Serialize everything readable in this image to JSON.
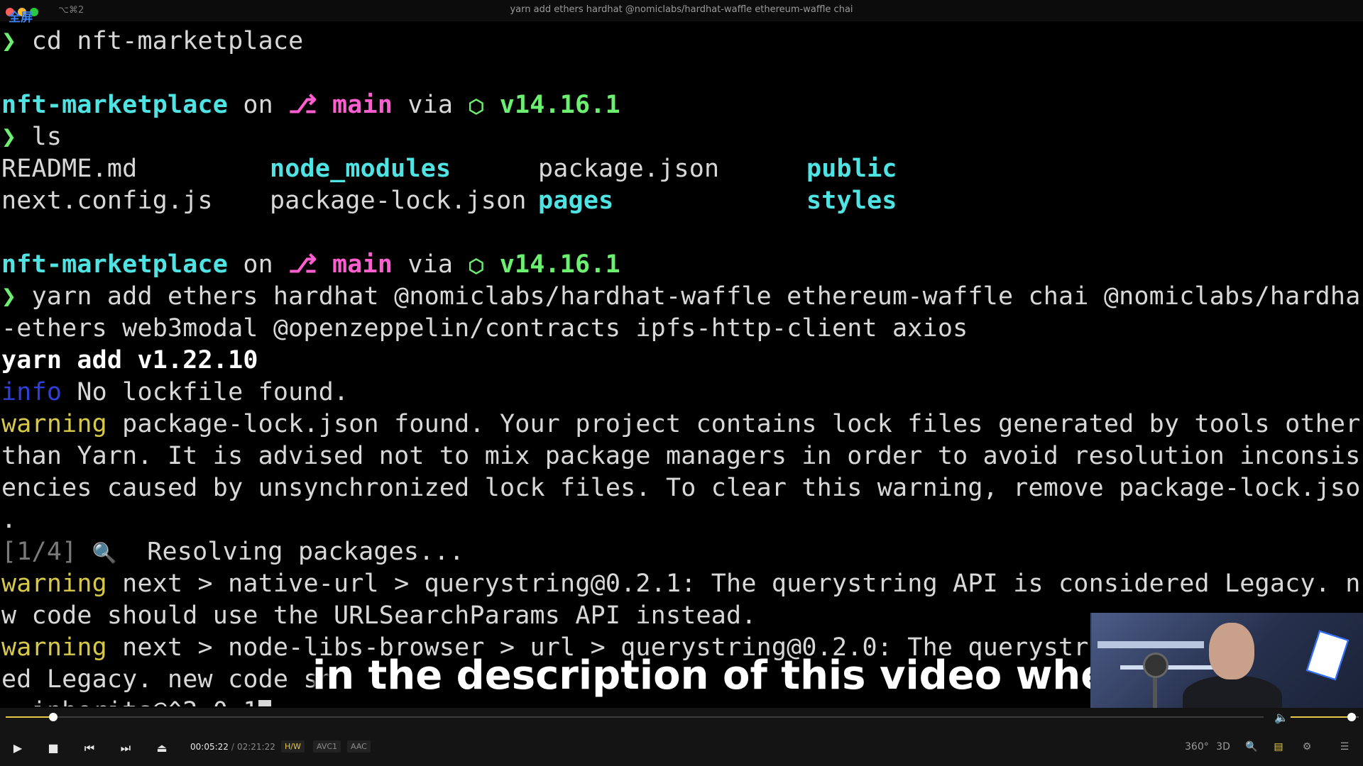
{
  "window": {
    "badge": "全屏",
    "shortcut": "⌥⌘2",
    "title": "yarn add ethers hardhat @nomiclabs/hardhat-waffle ethereum-waffle chai"
  },
  "terminal": {
    "cmd1": "cd nft-marketplace",
    "prompt": {
      "dir": "nft-marketplace",
      "on": "on",
      "branch": "main",
      "via": "via",
      "node": "v14.16.1"
    },
    "cmd2": "ls",
    "ls_row1": [
      "README.md",
      "node_modules",
      "package.json",
      "public"
    ],
    "ls_row2": [
      "next.config.js",
      "package-lock.json",
      "pages",
      "styles"
    ],
    "cmd3_line1": "yarn add ethers hardhat @nomiclabs/hardhat-waffle ethereum-waffle chai @nomiclabs/hardhat",
    "cmd3_line2": "-ethers web3modal @openzeppelin/contracts ipfs-http-client axios",
    "yarn_version": "yarn add v1.22.10",
    "info_label": "info",
    "info_text": " No lockfile found.",
    "warning_label": "warning",
    "warn1_l1": " package-lock.json found. Your project contains lock files generated by tools other",
    "warn1_l2": "than Yarn. It is advised not to mix package managers in order to avoid resolution inconsist",
    "warn1_l3": "encies caused by unsynchronized lock files. To clear this warning, remove package-lock.json",
    "warn1_l4": ".",
    "step_label": "[1/4]",
    "step_icon": "🔍",
    "step_text": "  Resolving packages...",
    "warn2_l1": " next > native-url > querystring@0.2.1: The querystring API is considered Legacy. ne",
    "warn2_l2": "w code should use the URLSearchParams API instead.",
    "warn3_l1": " next > node-libs-browser > url > querystring@0.2.0: The querystri",
    "warn3_l2": "ed Legacy. new code sh",
    "last_line": ": inherits@^2.0.1"
  },
  "caption": "in the description of this video where",
  "player": {
    "current_time": "00:05:22",
    "duration": "02:21:22",
    "progress": 0.038,
    "volume": 0.9,
    "tags": [
      "H/W",
      "AVC1",
      "AAC"
    ],
    "right_icons": [
      "360°",
      "3D"
    ],
    "colors": {
      "accent": "#e8c84a",
      "hw_tag": "#e8c84a",
      "tag_grey": "#8a8a8a"
    }
  }
}
